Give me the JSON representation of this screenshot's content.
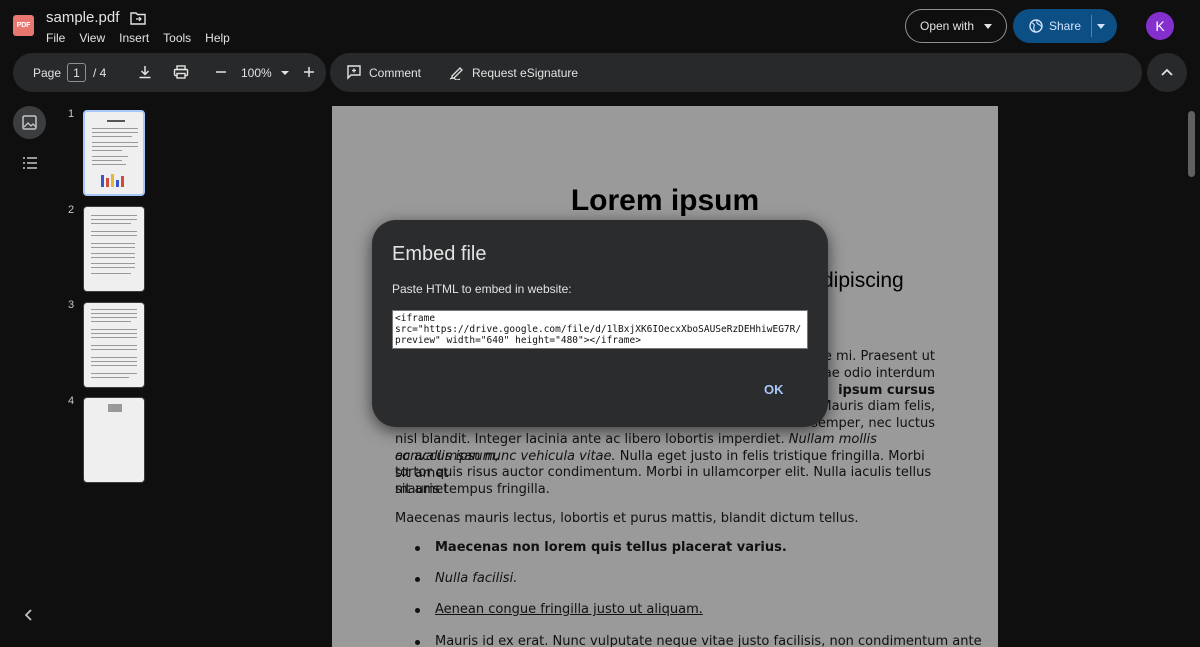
{
  "header": {
    "logo_text": "PDF",
    "file_name": "sample.pdf",
    "menu": [
      "File",
      "View",
      "Insert",
      "Tools",
      "Help"
    ],
    "open_with_label": "Open with",
    "share_label": "Share",
    "avatar_initial": "K",
    "colors": {
      "share_bg": "#0b4f85",
      "avatar_bg": "#8430ce",
      "logo_bg": "#e9776f"
    }
  },
  "toolbar": {
    "page_label": "Page",
    "current_page": "1",
    "total_pages": "/ 4",
    "zoom": "100%",
    "comment_label": "Comment",
    "esign_label": "Request eSignature"
  },
  "thumbnails": [
    "1",
    "2",
    "3",
    "4"
  ],
  "document": {
    "title": "Lorem ipsum",
    "heading_partial": "dipiscing",
    "lines": {
      "l1": "e mi. Praesent ut",
      "l2": "ae odio interdum",
      "l3": "ipsum cursus",
      "l4": "Mauris diam felis,",
      "l5": "semper, nec luctus",
      "l6a": "nisl blandit. Integer lacinia ante ac libero lobortis imperdiet. ",
      "l6b": "Nullam mollis convallis ipsum,",
      "l7a": "ac accumsan nunc vehicula vitae.",
      "l7b": " Nulla eget justo in felis tristique fringilla. Morbi sit amet",
      "l8": "tortor quis risus auctor condimentum. Morbi in ullamcorper elit. Nulla iaculis tellus sit amet",
      "l9": "mauris tempus fringilla.",
      "p2": "Maecenas mauris lectus, lobortis et purus mattis, blandit dictum tellus."
    },
    "bullets": [
      "Maecenas non lorem quis tellus placerat varius.",
      "Nulla facilisi.",
      "Aenean congue fringilla justo ut aliquam.",
      "Mauris id ex erat. Nunc vulputate neque vitae justo facilisis, non condimentum ante"
    ]
  },
  "dialog": {
    "title": "Embed file",
    "label": "Paste HTML to embed in website:",
    "embed_code": "<iframe\nsrc=\"https://drive.google.com/file/d/1lBxjXK6IOecxXboSAUSeRzDEHhiwEG7R/preview\" width=\"640\" height=\"480\"></iframe>",
    "ok_label": "OK",
    "accent": "#a8c7fa"
  }
}
